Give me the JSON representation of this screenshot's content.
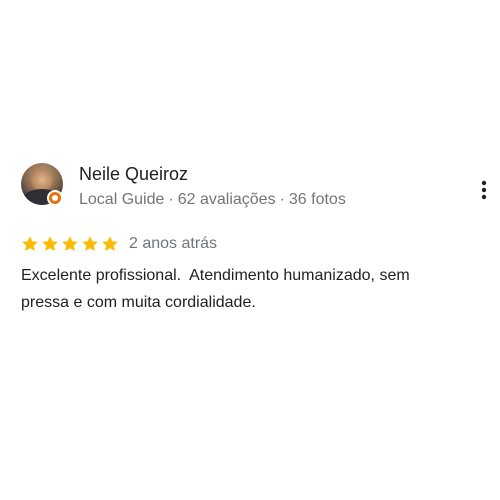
{
  "review": {
    "author_name": "Neile Queiroz",
    "author_meta": {
      "badge": "Local Guide",
      "reviews": "62 avaliações",
      "photos": "36 fotos",
      "separator": "·"
    },
    "rating": 5,
    "rating_max": 5,
    "date": "2 anos atrás",
    "text": "Excelente profissional.  Atendimento humanizado, sem\npressa e com muita cordialidade.",
    "icons": {
      "more": "more-vert-icon",
      "star": "star-icon",
      "local_guide": "local-guide-badge-icon"
    },
    "colors": {
      "star": "#fbbc04",
      "badge": "#e8710a",
      "secondary_text": "#70757a",
      "primary_text": "#202124"
    }
  }
}
